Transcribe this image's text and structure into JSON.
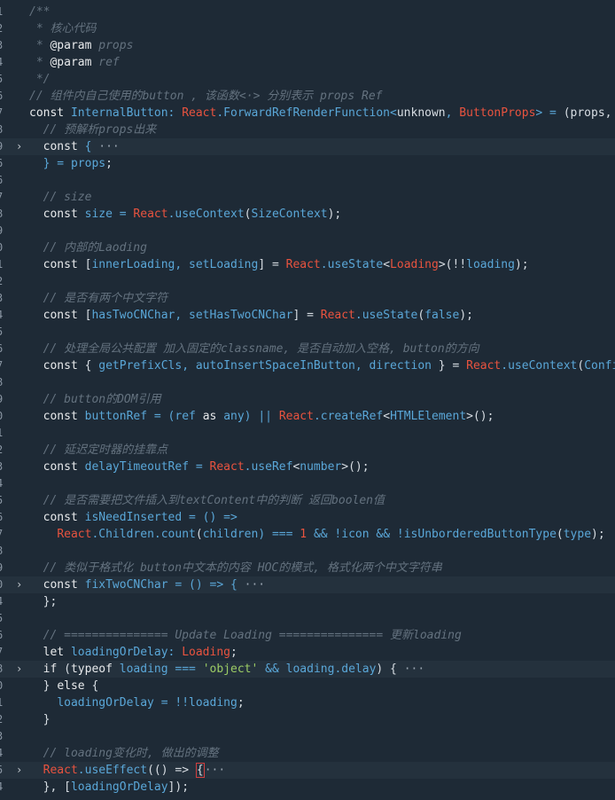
{
  "theme": {
    "background": "#1e2a36",
    "comment": "#64727f",
    "keyword": "#e8eaec",
    "identifier": "#5aa7d8",
    "react": "#e8533f",
    "text": "#d7dde3",
    "string": "#9ccc65",
    "number": "#e8533f",
    "punct": "#5aa7d8"
  },
  "lines": [
    {
      "num": "1",
      "tokens": [
        [
          "/**",
          "c"
        ]
      ]
    },
    {
      "num": "2",
      "tokens": [
        [
          " * 核心代码",
          "c"
        ]
      ]
    },
    {
      "num": "3",
      "tokens": [
        [
          " * ",
          "c"
        ],
        [
          "@param",
          "kw"
        ],
        [
          " props",
          "ci"
        ]
      ]
    },
    {
      "num": "4",
      "tokens": [
        [
          " * ",
          "c"
        ],
        [
          "@param",
          "kw"
        ],
        [
          " ref",
          "ci"
        ]
      ]
    },
    {
      "num": "5",
      "tokens": [
        [
          " */",
          "c"
        ]
      ]
    },
    {
      "num": "6",
      "tokens": [
        [
          "// 组件内自己使用的button , 该函数<·> 分别表示 props Ref",
          "c"
        ]
      ]
    },
    {
      "num": "7",
      "tokens": [
        [
          "const ",
          "kw"
        ],
        [
          "InternalButton",
          "id"
        ],
        [
          ": ",
          "p"
        ],
        [
          "React",
          "r"
        ],
        [
          ".",
          "p"
        ],
        [
          "ForwardRefRenderFunction",
          "id"
        ],
        [
          "<",
          "p"
        ],
        [
          "unknown",
          "t"
        ],
        [
          ", ",
          "p"
        ],
        [
          "ButtonProps",
          "r"
        ],
        [
          "> = ",
          "p"
        ],
        [
          "(props, r",
          "t"
        ]
      ]
    },
    {
      "num": "8",
      "tokens": [
        [
          "  // 预解析props出来",
          "c"
        ]
      ]
    },
    {
      "num": "9",
      "fold": true,
      "tokens": [
        [
          "  ",
          "t"
        ],
        [
          "const",
          "kw"
        ],
        [
          " { ",
          "p"
        ],
        [
          "···",
          "e"
        ]
      ]
    },
    {
      "num": "6",
      "tokens": [
        [
          "  } = ",
          "p"
        ],
        [
          "props",
          "id"
        ],
        [
          ";",
          "t"
        ]
      ]
    },
    {
      "num": "6",
      "tokens": [
        [
          "",
          "t"
        ]
      ]
    },
    {
      "num": "7",
      "tokens": [
        [
          "  // size",
          "c"
        ]
      ]
    },
    {
      "num": "8",
      "tokens": [
        [
          "  ",
          "t"
        ],
        [
          "const ",
          "kw"
        ],
        [
          "size",
          "id"
        ],
        [
          " = ",
          "p"
        ],
        [
          "React",
          "r"
        ],
        [
          ".",
          "p"
        ],
        [
          "useContext",
          "id"
        ],
        [
          "(",
          "t"
        ],
        [
          "SizeContext",
          "id"
        ],
        [
          ");",
          "t"
        ]
      ]
    },
    {
      "num": "9",
      "tokens": [
        [
          "",
          "t"
        ]
      ]
    },
    {
      "num": "0",
      "tokens": [
        [
          "  // 内部的Laoding",
          "c"
        ]
      ]
    },
    {
      "num": "1",
      "tokens": [
        [
          "  ",
          "t"
        ],
        [
          "const ",
          "kw"
        ],
        [
          "[",
          "t"
        ],
        [
          "innerLoading",
          "id"
        ],
        [
          ", ",
          "p"
        ],
        [
          "setLoading",
          "id"
        ],
        [
          "] = ",
          "t"
        ],
        [
          "React",
          "r"
        ],
        [
          ".",
          "p"
        ],
        [
          "useState",
          "id"
        ],
        [
          "<",
          "t"
        ],
        [
          "Loading",
          "r"
        ],
        [
          ">(!!",
          "t"
        ],
        [
          "loading",
          "id"
        ],
        [
          ");",
          "t"
        ]
      ]
    },
    {
      "num": "2",
      "tokens": [
        [
          "",
          "t"
        ]
      ]
    },
    {
      "num": "3",
      "tokens": [
        [
          "  // 是否有两个中文字符",
          "c"
        ]
      ]
    },
    {
      "num": "4",
      "tokens": [
        [
          "  ",
          "t"
        ],
        [
          "const ",
          "kw"
        ],
        [
          "[",
          "t"
        ],
        [
          "hasTwoCNChar",
          "id"
        ],
        [
          ", ",
          "p"
        ],
        [
          "setHasTwoCNChar",
          "id"
        ],
        [
          "] = ",
          "t"
        ],
        [
          "React",
          "r"
        ],
        [
          ".",
          "p"
        ],
        [
          "useState",
          "id"
        ],
        [
          "(",
          "t"
        ],
        [
          "false",
          "id"
        ],
        [
          ");",
          "t"
        ]
      ]
    },
    {
      "num": "5",
      "tokens": [
        [
          "",
          "t"
        ]
      ]
    },
    {
      "num": "6",
      "tokens": [
        [
          "  // 处理全局公共配置 加入固定的classname, 是否自动加入空格, button的方向",
          "c"
        ]
      ]
    },
    {
      "num": "7",
      "tokens": [
        [
          "  ",
          "t"
        ],
        [
          "const ",
          "kw"
        ],
        [
          "{ ",
          "t"
        ],
        [
          "getPrefixCls",
          "id"
        ],
        [
          ", ",
          "p"
        ],
        [
          "autoInsertSpaceInButton",
          "id"
        ],
        [
          ", ",
          "p"
        ],
        [
          "direction",
          "id"
        ],
        [
          " } = ",
          "t"
        ],
        [
          "React",
          "r"
        ],
        [
          ".",
          "p"
        ],
        [
          "useContext",
          "id"
        ],
        [
          "(",
          "t"
        ],
        [
          "Config",
          "id"
        ]
      ]
    },
    {
      "num": "8",
      "tokens": [
        [
          "",
          "t"
        ]
      ]
    },
    {
      "num": "9",
      "tokens": [
        [
          "  // button的DOM引用",
          "c"
        ]
      ]
    },
    {
      "num": "0",
      "tokens": [
        [
          "  ",
          "t"
        ],
        [
          "const ",
          "kw"
        ],
        [
          "buttonRef",
          "id"
        ],
        [
          " = (",
          "p"
        ],
        [
          "ref",
          "id"
        ],
        [
          " as ",
          "kw"
        ],
        [
          "any",
          "id"
        ],
        [
          ") || ",
          "p"
        ],
        [
          "React",
          "r"
        ],
        [
          ".",
          "p"
        ],
        [
          "createRef",
          "id"
        ],
        [
          "<",
          "t"
        ],
        [
          "HTMLElement",
          "id"
        ],
        [
          ">();",
          "t"
        ]
      ]
    },
    {
      "num": "1",
      "tokens": [
        [
          "",
          "t"
        ]
      ]
    },
    {
      "num": "2",
      "tokens": [
        [
          "  // 延迟定时器的挂靠点",
          "c"
        ]
      ]
    },
    {
      "num": "3",
      "tokens": [
        [
          "  ",
          "t"
        ],
        [
          "const ",
          "kw"
        ],
        [
          "delayTimeoutRef",
          "id"
        ],
        [
          " = ",
          "p"
        ],
        [
          "React",
          "r"
        ],
        [
          ".",
          "p"
        ],
        [
          "useRef",
          "id"
        ],
        [
          "<",
          "t"
        ],
        [
          "number",
          "id"
        ],
        [
          ">();",
          "t"
        ]
      ]
    },
    {
      "num": "4",
      "tokens": [
        [
          "",
          "t"
        ]
      ]
    },
    {
      "num": "5",
      "tokens": [
        [
          "  // 是否需要把文件插入到textContent中的判断 返回boolen值",
          "c"
        ]
      ]
    },
    {
      "num": "6",
      "tokens": [
        [
          "  ",
          "t"
        ],
        [
          "const ",
          "kw"
        ],
        [
          "isNeedInserted",
          "id"
        ],
        [
          " = () =>",
          "p"
        ]
      ]
    },
    {
      "num": "7",
      "tokens": [
        [
          "    ",
          "t"
        ],
        [
          "React",
          "r"
        ],
        [
          ".",
          "p"
        ],
        [
          "Children",
          "id"
        ],
        [
          ".",
          "p"
        ],
        [
          "count",
          "id"
        ],
        [
          "(",
          "t"
        ],
        [
          "children",
          "id"
        ],
        [
          ") === ",
          "p"
        ],
        [
          "1",
          "n"
        ],
        [
          " && !",
          "p"
        ],
        [
          "icon",
          "id"
        ],
        [
          " && !",
          "p"
        ],
        [
          "isUnborderedButtonType",
          "id"
        ],
        [
          "(",
          "t"
        ],
        [
          "type",
          "id"
        ],
        [
          ");",
          "t"
        ]
      ]
    },
    {
      "num": "8",
      "tokens": [
        [
          "",
          "t"
        ]
      ]
    },
    {
      "num": "9",
      "tokens": [
        [
          "  // 类似于格式化 button中文本的内容 HOC的模式, 格式化两个中文字符串",
          "c"
        ]
      ]
    },
    {
      "num": "0",
      "fold": true,
      "tokens": [
        [
          "  ",
          "t"
        ],
        [
          "const ",
          "kw"
        ],
        [
          "fixTwoCNChar",
          "id"
        ],
        [
          " = () => { ",
          "p"
        ],
        [
          "···",
          "e"
        ]
      ]
    },
    {
      "num": "4",
      "tokens": [
        [
          "  };",
          "t"
        ]
      ]
    },
    {
      "num": "5",
      "tokens": [
        [
          "",
          "t"
        ]
      ]
    },
    {
      "num": "6",
      "tokens": [
        [
          "  // =============== Update Loading =============== 更新loading",
          "c"
        ]
      ]
    },
    {
      "num": "7",
      "tokens": [
        [
          "  ",
          "t"
        ],
        [
          "let ",
          "kw"
        ],
        [
          "loadingOrDelay",
          "id"
        ],
        [
          ": ",
          "p"
        ],
        [
          "Loading",
          "r"
        ],
        [
          ";",
          "t"
        ]
      ]
    },
    {
      "num": "8",
      "fold": true,
      "tokens": [
        [
          "  ",
          "t"
        ],
        [
          "if ",
          "kw"
        ],
        [
          "(",
          "t"
        ],
        [
          "typeof ",
          "kw"
        ],
        [
          "loading",
          "id"
        ],
        [
          " === ",
          "p"
        ],
        [
          "'object'",
          "s"
        ],
        [
          " && ",
          "p"
        ],
        [
          "loading",
          "id"
        ],
        [
          ".",
          "p"
        ],
        [
          "delay",
          "id"
        ],
        [
          ") { ",
          "t"
        ],
        [
          "···",
          "e"
        ]
      ]
    },
    {
      "num": "0",
      "tokens": [
        [
          "  } ",
          "t"
        ],
        [
          "else",
          "kw"
        ],
        [
          " {",
          "t"
        ]
      ]
    },
    {
      "num": "1",
      "tokens": [
        [
          "    ",
          "t"
        ],
        [
          "loadingOrDelay",
          "id"
        ],
        [
          " = !!",
          "p"
        ],
        [
          "loading",
          "id"
        ],
        [
          ";",
          "t"
        ]
      ]
    },
    {
      "num": "2",
      "tokens": [
        [
          "  }",
          "t"
        ]
      ]
    },
    {
      "num": "3",
      "tokens": [
        [
          "",
          "t"
        ]
      ]
    },
    {
      "num": "4",
      "tokens": [
        [
          "  // loading变化时, 做出的调整",
          "c"
        ]
      ]
    },
    {
      "num": "5",
      "fold": true,
      "tokens": [
        [
          "  ",
          "t"
        ],
        [
          "React",
          "r"
        ],
        [
          ".",
          "p"
        ],
        [
          "useEffect",
          "id"
        ],
        [
          "(() => ",
          "t"
        ],
        [
          "{",
          "box"
        ],
        [
          "···",
          "e"
        ]
      ]
    },
    {
      "num": "4",
      "tokens": [
        [
          "  }, [",
          "t"
        ],
        [
          "loadingOrDelay",
          "id"
        ],
        [
          "]);",
          "t"
        ]
      ]
    }
  ]
}
